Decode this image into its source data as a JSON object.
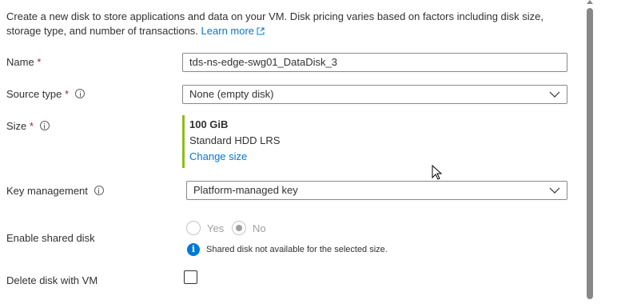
{
  "intro": {
    "text": "Create a new disk to store applications and data on your VM. Disk pricing varies based on factors including disk size, storage type, and number of transactions.",
    "learn_more": "Learn more"
  },
  "fields": {
    "name": {
      "label": "Name",
      "required": "*",
      "value": "tds-ns-edge-swg01_DataDisk_3"
    },
    "source_type": {
      "label": "Source type",
      "required": "*",
      "value": "None (empty disk)"
    },
    "size": {
      "label": "Size",
      "required": "*",
      "amount": "100 GiB",
      "sku": "Standard HDD LRS",
      "change_link": "Change size"
    },
    "key_management": {
      "label": "Key management",
      "value": "Platform-managed key"
    },
    "shared_disk": {
      "label": "Enable shared disk",
      "yes": "Yes",
      "no": "No",
      "selected": "No",
      "notice": "Shared disk not available for the selected size."
    },
    "delete_with_vm": {
      "label": "Delete disk with VM",
      "checked": false
    }
  },
  "colors": {
    "link": "#0078d4",
    "accent_bar": "#8cbd18",
    "required": "#a4262c"
  },
  "icons": [
    "external-link-icon",
    "info-icon",
    "chevron-down-icon",
    "mouse-cursor-icon"
  ]
}
